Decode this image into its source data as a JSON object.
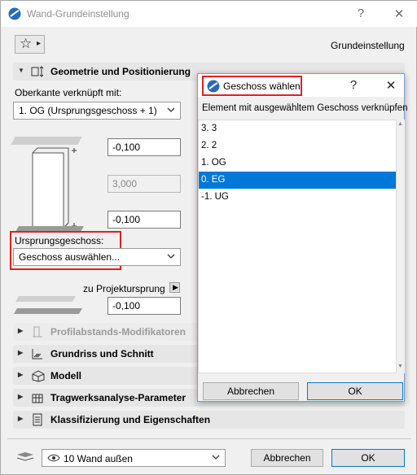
{
  "window": {
    "title": "Wand-Grundeinstellung",
    "help_label": "?",
    "close_label": "✕",
    "favorite_star": "☆",
    "favorite_arrow": "▸",
    "preset_label": "Grundeinstellung"
  },
  "geometry_section": {
    "label": "Geometrie und Positionierung",
    "top_link_label": "Oberkante verknüpft mit:",
    "top_link_value": "1. OG (Ursprungsgeschoss + 1)",
    "top_offset": "-0,100",
    "height": "3,000",
    "bottom_offset": "-0,100",
    "origin_floor_label": "Ursprungsgeschoss:",
    "origin_floor_value": "Geschoss auswählen...",
    "project_origin_label": "zu Projektursprung",
    "project_origin_value": "-0,100"
  },
  "sections": [
    {
      "label": "Profilabstands-Modifikatoren",
      "icon": "profile-modifier-icon",
      "disabled": true
    },
    {
      "label": "Grundriss und Schnitt",
      "icon": "floor-plan-icon",
      "disabled": false
    },
    {
      "label": "Modell",
      "icon": "model-icon",
      "disabled": false
    },
    {
      "label": "Tragwerksanalyse-Parameter",
      "icon": "structural-analysis-icon",
      "disabled": false
    },
    {
      "label": "Klassifizierung und Eigenschaften",
      "icon": "classification-icon",
      "disabled": false
    }
  ],
  "footer": {
    "layer_value": "10 Wand außen",
    "cancel_label": "Abbrechen",
    "ok_label": "OK"
  },
  "dialog": {
    "title": "Geschoss wählen",
    "help_label": "?",
    "close_label": "✕",
    "instruction": "Element mit ausgewähltem Geschoss verknüpfen",
    "floors": [
      "3. 3",
      "2. 2",
      "1. OG",
      "0. EG",
      "-1. UG"
    ],
    "selected_floor": "0. EG",
    "cancel_label": "Abbrechen",
    "ok_label": "OK"
  },
  "colors": {
    "selection": "#0078d7",
    "highlight_box": "#e02020"
  }
}
